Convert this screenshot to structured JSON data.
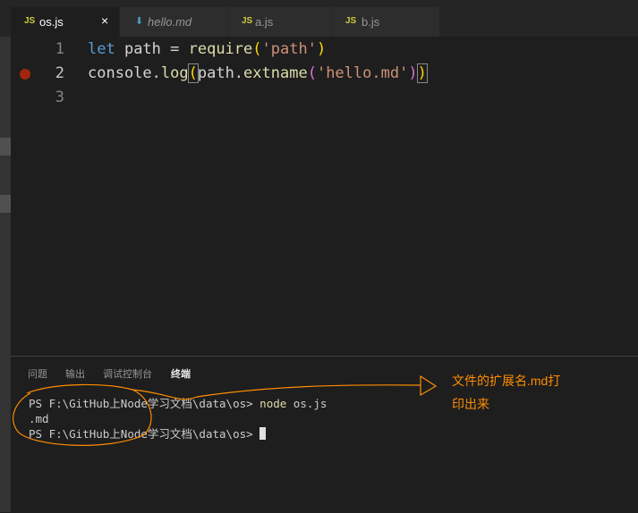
{
  "tabs": [
    {
      "label": "os.js",
      "kind": "JS",
      "active": true,
      "close": "×"
    },
    {
      "label": "hello.md",
      "kind": "md",
      "active": false
    },
    {
      "label": "a.js",
      "kind": "JS",
      "active": false
    },
    {
      "label": "b.js",
      "kind": "JS",
      "active": false
    }
  ],
  "editor": {
    "lines": [
      {
        "number": "1",
        "tokens": {
          "kw": "let",
          "name": " path = ",
          "fn": "require",
          "open": "(",
          "str": "'path'",
          "close": ")"
        }
      },
      {
        "number": "2",
        "breakpoint": true,
        "tokens": {
          "obj": "console.",
          "fn": "log",
          "open": "(",
          "mid": "path.",
          "fn2": "extname",
          "open2": "(",
          "str": "'hello.md'",
          "close2": ")",
          "close": ")"
        }
      },
      {
        "number": "3"
      }
    ]
  },
  "panel": {
    "tabs": [
      "问题",
      "输出",
      "调试控制台",
      "终端"
    ],
    "active_tab": "终端",
    "terminal": {
      "line1_prompt": "PS F:\\GitHub上Node学习文档\\data\\os> ",
      "line1_cmd": "node",
      "line1_arg": " os.js",
      "line2": ".md",
      "line3_prompt": "PS F:\\GitHub上Node学习文档\\data\\os> "
    }
  },
  "annotation": {
    "line1": "文件的扩展名.md打",
    "line2": "印出来",
    "color": "#ff8c00"
  },
  "colors": {
    "keyword": "#569cd6",
    "string": "#ce9178",
    "function": "#dcdcaa",
    "bracket": "#ffd700",
    "bracket_nested": "#da70d6",
    "breakpoint": "#a1260d",
    "js_badge": "#cbcb41",
    "md_icon": "#519aba"
  }
}
